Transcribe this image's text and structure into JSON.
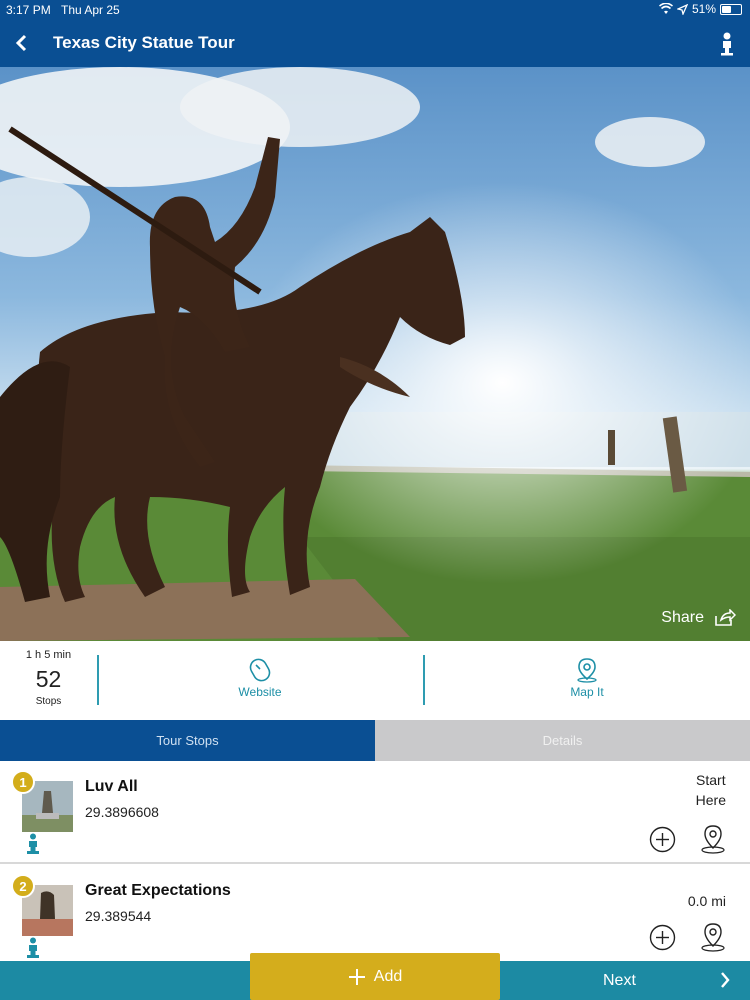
{
  "status_bar": {
    "time": "3:17 PM",
    "date": "Thu Apr 25",
    "battery": "51%"
  },
  "nav": {
    "title": "Texas City Statue Tour"
  },
  "hero": {
    "share_label": "Share"
  },
  "info": {
    "duration": "1 h 5 min",
    "stop_count": "52",
    "stops_label": "Stops",
    "website_label": "Website",
    "map_label": "Map It"
  },
  "tabs": [
    {
      "label": "Tour Stops",
      "active": true
    },
    {
      "label": "Details",
      "active": false
    }
  ],
  "stops": [
    {
      "number": "1",
      "name": "Luv All",
      "coordinate": "29.3896608",
      "distance_line1": "Start",
      "distance_line2": "Here"
    },
    {
      "number": "2",
      "name": "Great Expectations",
      "coordinate": "29.389544",
      "distance_line1": "0.0 mi",
      "distance_line2": ""
    }
  ],
  "bottom": {
    "add_label": "Add",
    "next_label": "Next"
  },
  "colors": {
    "primary": "#0a4f93",
    "teal": "#1c8aa3",
    "gold": "#d4ad1c"
  }
}
